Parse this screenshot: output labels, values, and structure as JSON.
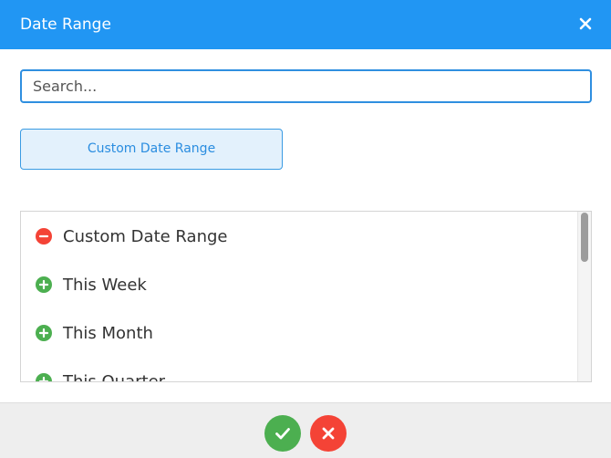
{
  "dialog": {
    "title": "Date Range",
    "close_icon": "close-icon"
  },
  "search": {
    "placeholder": "Search..."
  },
  "custom_button": {
    "label": "Custom Date Range"
  },
  "list": {
    "items": [
      {
        "label": "Custom Date Range",
        "icon": "minus-circle-icon",
        "state": "selected"
      },
      {
        "label": "This Week",
        "icon": "plus-circle-icon",
        "state": "available"
      },
      {
        "label": "This Month",
        "icon": "plus-circle-icon",
        "state": "available"
      },
      {
        "label": "This Quarter",
        "icon": "plus-circle-icon",
        "state": "available"
      }
    ]
  },
  "footer": {
    "confirm_icon": "check-icon",
    "cancel_icon": "close-icon"
  },
  "colors": {
    "header": "#2196f3",
    "accent": "#2a8de0",
    "remove": "#f44336",
    "add": "#4caf50"
  }
}
